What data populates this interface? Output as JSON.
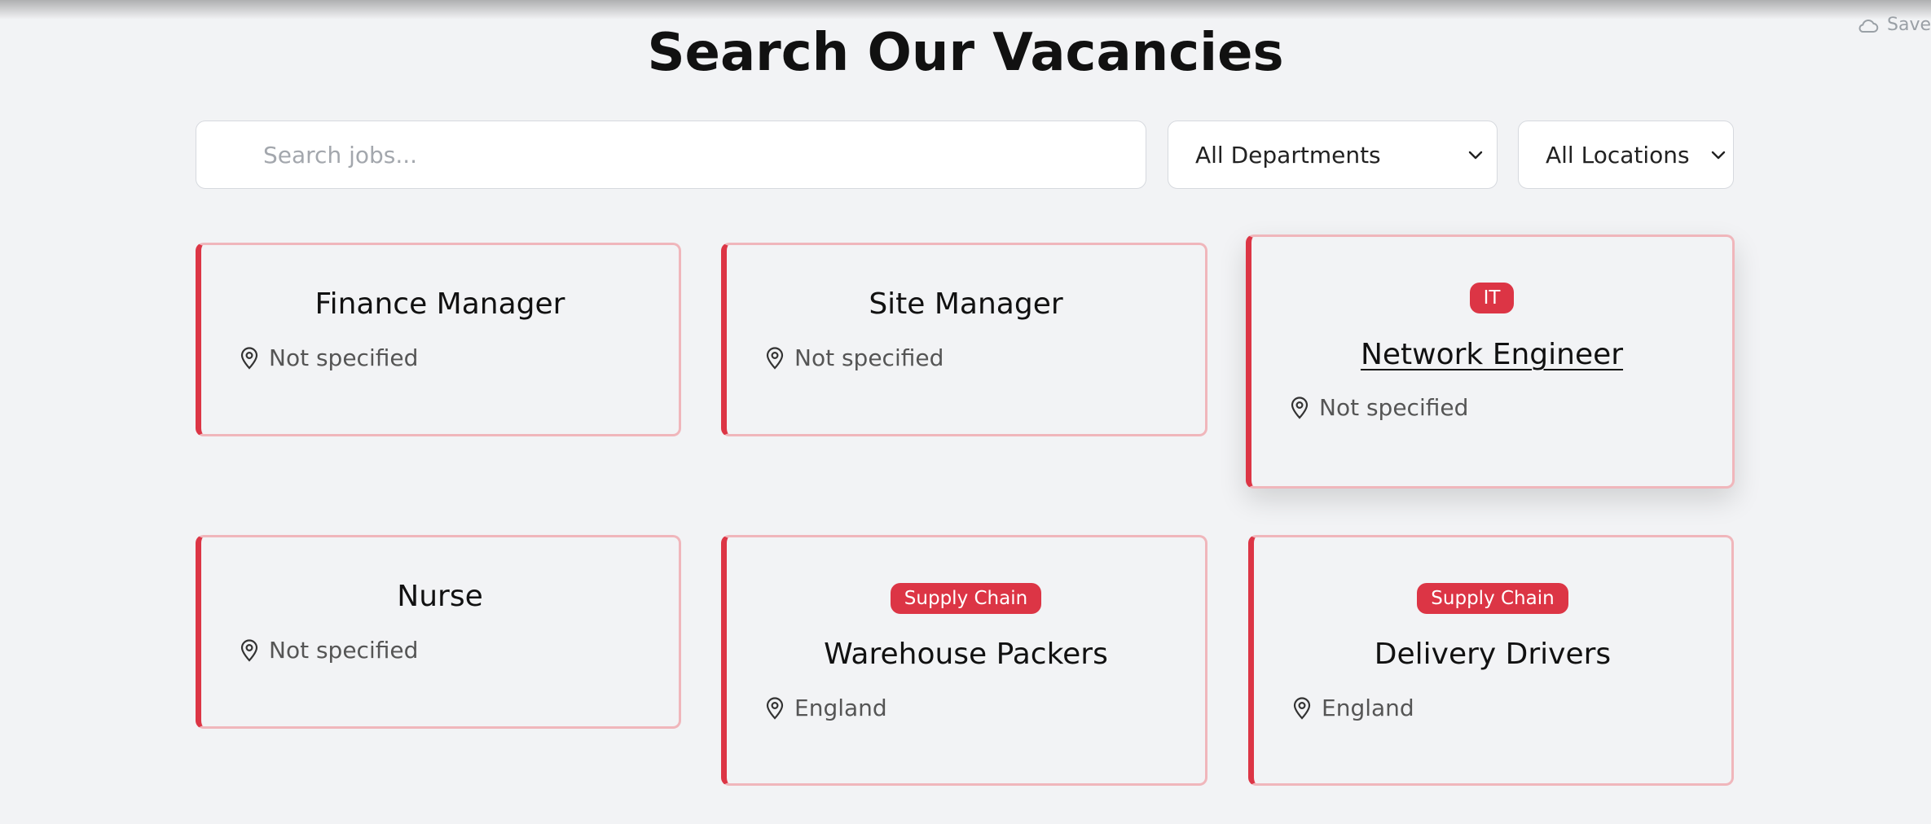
{
  "header": {
    "save_label": "Save",
    "title": "Search Our Vacancies"
  },
  "filters": {
    "search_placeholder": "Search jobs...",
    "search_value": "",
    "department_selected": "All Departments",
    "location_selected": "All Locations"
  },
  "jobs": [
    {
      "badge": "",
      "title": "Finance Manager",
      "location": "Not specified"
    },
    {
      "badge": "",
      "title": "Site Manager",
      "location": "Not specified"
    },
    {
      "badge": "IT",
      "title": "Network Engineer",
      "location": "Not specified"
    },
    {
      "badge": "",
      "title": "Nurse",
      "location": "Not specified"
    },
    {
      "badge": "Supply Chain",
      "title": "Warehouse Packers",
      "location": "England"
    },
    {
      "badge": "Supply Chain",
      "title": "Delivery Drivers",
      "location": "England"
    }
  ],
  "colors": {
    "accent": "#dc3545",
    "card_border": "#f0b6bb",
    "background": "#f2f3f5"
  },
  "icons": {
    "save": "cloud-icon",
    "location": "map-pin-icon",
    "dropdown": "chevron-down-icon"
  }
}
